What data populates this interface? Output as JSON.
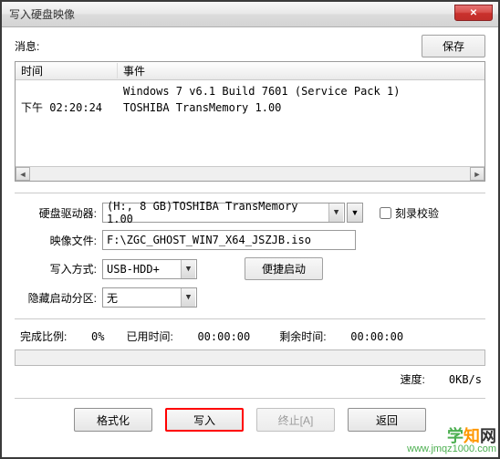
{
  "window": {
    "title": "写入硬盘映像",
    "close_glyph": "✕"
  },
  "top": {
    "message_label": "消息:",
    "save_button": "保存"
  },
  "log": {
    "col_time": "时间",
    "col_event": "事件",
    "rows": [
      {
        "time": "",
        "event": "Windows 7 v6.1 Build 7601 (Service Pack 1)"
      },
      {
        "time": "下午 02:20:24",
        "event": "TOSHIBA TransMemory    1.00"
      }
    ],
    "scroll_left": "◄",
    "scroll_right": "►"
  },
  "form": {
    "hdd_label": "硬盘驱动器:",
    "hdd_value": "(H:, 8 GB)TOSHIBA TransMemory    1.00",
    "verify_label": "刻录校验",
    "image_label": "映像文件:",
    "image_value": "F:\\ZGC_GHOST_WIN7_X64_JSZJB.iso",
    "write_mode_label": "写入方式:",
    "write_mode_value": "USB-HDD+",
    "quick_boot_button": "便捷启动",
    "hidden_label": "隐藏启动分区:",
    "hidden_value": "无"
  },
  "progress": {
    "done_label": "完成比例:",
    "done_value": "0%",
    "used_label": "已用时间:",
    "used_value": "00:00:00",
    "remain_label": "剩余时间:",
    "remain_value": "00:00:00",
    "speed_label": "速度:",
    "speed_value": "0KB/s"
  },
  "buttons": {
    "format": "格式化",
    "write": "写入",
    "abort": "终止[A]",
    "back": "返回"
  },
  "watermark": {
    "brand_1": "学",
    "brand_2": "知",
    "brand_3": "网",
    "url": "www.jmqz1000.com"
  },
  "glyphs": {
    "down": "▼"
  }
}
